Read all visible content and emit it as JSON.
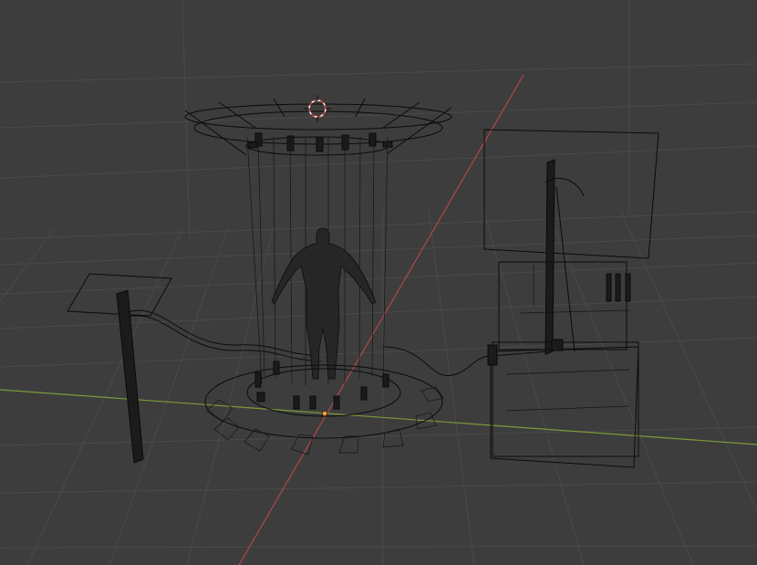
{
  "viewport": {
    "background_color": "#3d3d3d",
    "grid_color": "#4a4a4a",
    "x_axis_color": "#7c9a3a",
    "y_axis_color": "#b0474a",
    "wireframe_color": "#0b0b0b",
    "shading_mode": "wireframe",
    "icons": {
      "cursor": "3d-cursor-icon",
      "origin": "object-origin-icon"
    }
  }
}
